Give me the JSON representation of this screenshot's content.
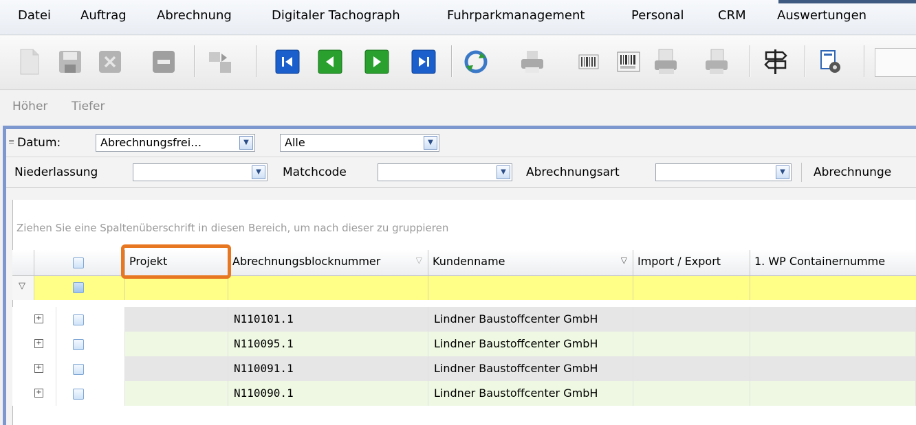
{
  "menu": {
    "items": [
      "Datei",
      "Auftrag",
      "Abrechnung",
      "Digitaler Tachograph",
      "Fuhrparkmanagement",
      "Personal",
      "CRM",
      "Auswertungen"
    ]
  },
  "toolbar": {
    "icons": [
      "new-document-icon",
      "save-icon",
      "delete-icon",
      "remove-icon",
      "copy-transfer-icon",
      "first-record-icon",
      "previous-record-icon",
      "next-record-icon",
      "last-record-icon",
      "refresh-icon",
      "print-icon",
      "barcode-icon",
      "barcode-label-icon",
      "print-preview-icon",
      "export-icon",
      "signpost-icon",
      "settings-document-icon"
    ]
  },
  "subbar": {
    "up_label": "Höher",
    "down_label": "Tiefer"
  },
  "filters": {
    "date_label": "Datum:",
    "date_field_value": "Abrechnungsfrei…",
    "date_range_value": "Alle",
    "branch_label": "Niederlassung",
    "branch_value": "",
    "matchcode_label": "Matchcode",
    "matchcode_value": "",
    "billing_type_label": "Abrechnungsart",
    "billing_type_value": "",
    "billing_more_label": "Abrechnunge"
  },
  "grid": {
    "group_hint": "Ziehen Sie eine Spaltenüberschrift in diesen Bereich, um nach dieser zu gruppieren",
    "columns": [
      "Projekt",
      "Abrechnungsblocknummer",
      "Kundenname",
      "Import / Export",
      "1. WP Containernumme"
    ],
    "highlight_color": "#e87722",
    "filter_row_color": "#ffff88",
    "rows": [
      {
        "projekt": "",
        "blocknummer": "N110101.1",
        "kundenname": "Lindner Baustoffcenter GmbH",
        "import_export": "",
        "container": ""
      },
      {
        "projekt": "",
        "blocknummer": "N110095.1",
        "kundenname": "Lindner Baustoffcenter GmbH",
        "import_export": "",
        "container": ""
      },
      {
        "projekt": "",
        "blocknummer": "N110091.1",
        "kundenname": "Lindner Baustoffcenter GmbH",
        "import_export": "",
        "container": ""
      },
      {
        "projekt": "",
        "blocknummer": "N110090.1",
        "kundenname": "Lindner Baustoffcenter GmbH",
        "import_export": "",
        "container": ""
      }
    ]
  }
}
